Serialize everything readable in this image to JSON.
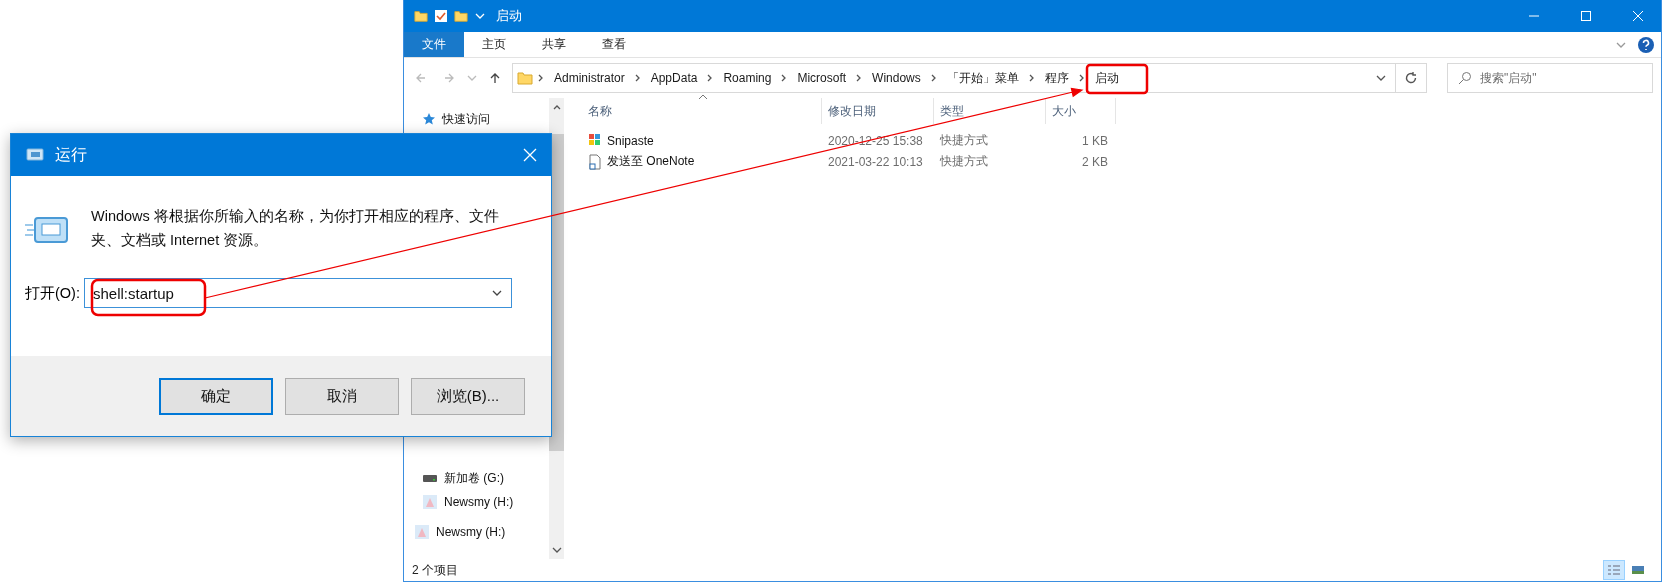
{
  "explorer": {
    "title": "启动",
    "ribbon_tabs": [
      {
        "label": "文件",
        "selected": true
      },
      {
        "label": "主页",
        "selected": false
      },
      {
        "label": "共享",
        "selected": false
      },
      {
        "label": "查看",
        "selected": false
      }
    ],
    "breadcrumb": [
      {
        "label": "Administrator"
      },
      {
        "label": "AppData"
      },
      {
        "label": "Roaming"
      },
      {
        "label": "Microsoft"
      },
      {
        "label": "Windows"
      },
      {
        "label": "「开始」菜单"
      },
      {
        "label": "程序"
      },
      {
        "label": "启动"
      }
    ],
    "search": {
      "placeholder": "搜索\"启动\""
    },
    "nav": {
      "quick_access": "快速访问",
      "drives": [
        {
          "label": "新加卷 (G:)",
          "kind": "drive"
        },
        {
          "label": "Newsmy (H:)",
          "kind": "removable"
        }
      ],
      "removable": {
        "label": "Newsmy (H:)",
        "kind": "removable"
      }
    },
    "columns": [
      "名称",
      "修改日期",
      "类型",
      "大小"
    ],
    "rows": [
      {
        "name": "Snipaste",
        "kind": "app",
        "modified": "2020-12-25 15:38",
        "type": "快捷方式",
        "size": "1 KB"
      },
      {
        "name": "发送至 OneNote",
        "kind": "file",
        "modified": "2021-03-22 10:13",
        "type": "快捷方式",
        "size": "2 KB"
      }
    ],
    "status": "2 个项目",
    "view_buttons": [
      {
        "kind": "details",
        "selected": true
      },
      {
        "kind": "tiles",
        "selected": false
      }
    ]
  },
  "run_dialog": {
    "title": "运行",
    "message": "Windows 将根据你所输入的名称，为你打开相应的程序、文件夹、文档或 Internet 资源。",
    "open_label": "打开(O):",
    "value": "shell:startup",
    "buttons": [
      {
        "label": "确定",
        "selected": true
      },
      {
        "label": "取消",
        "selected": false
      },
      {
        "label": "浏览(B)...",
        "selected": false
      }
    ]
  }
}
